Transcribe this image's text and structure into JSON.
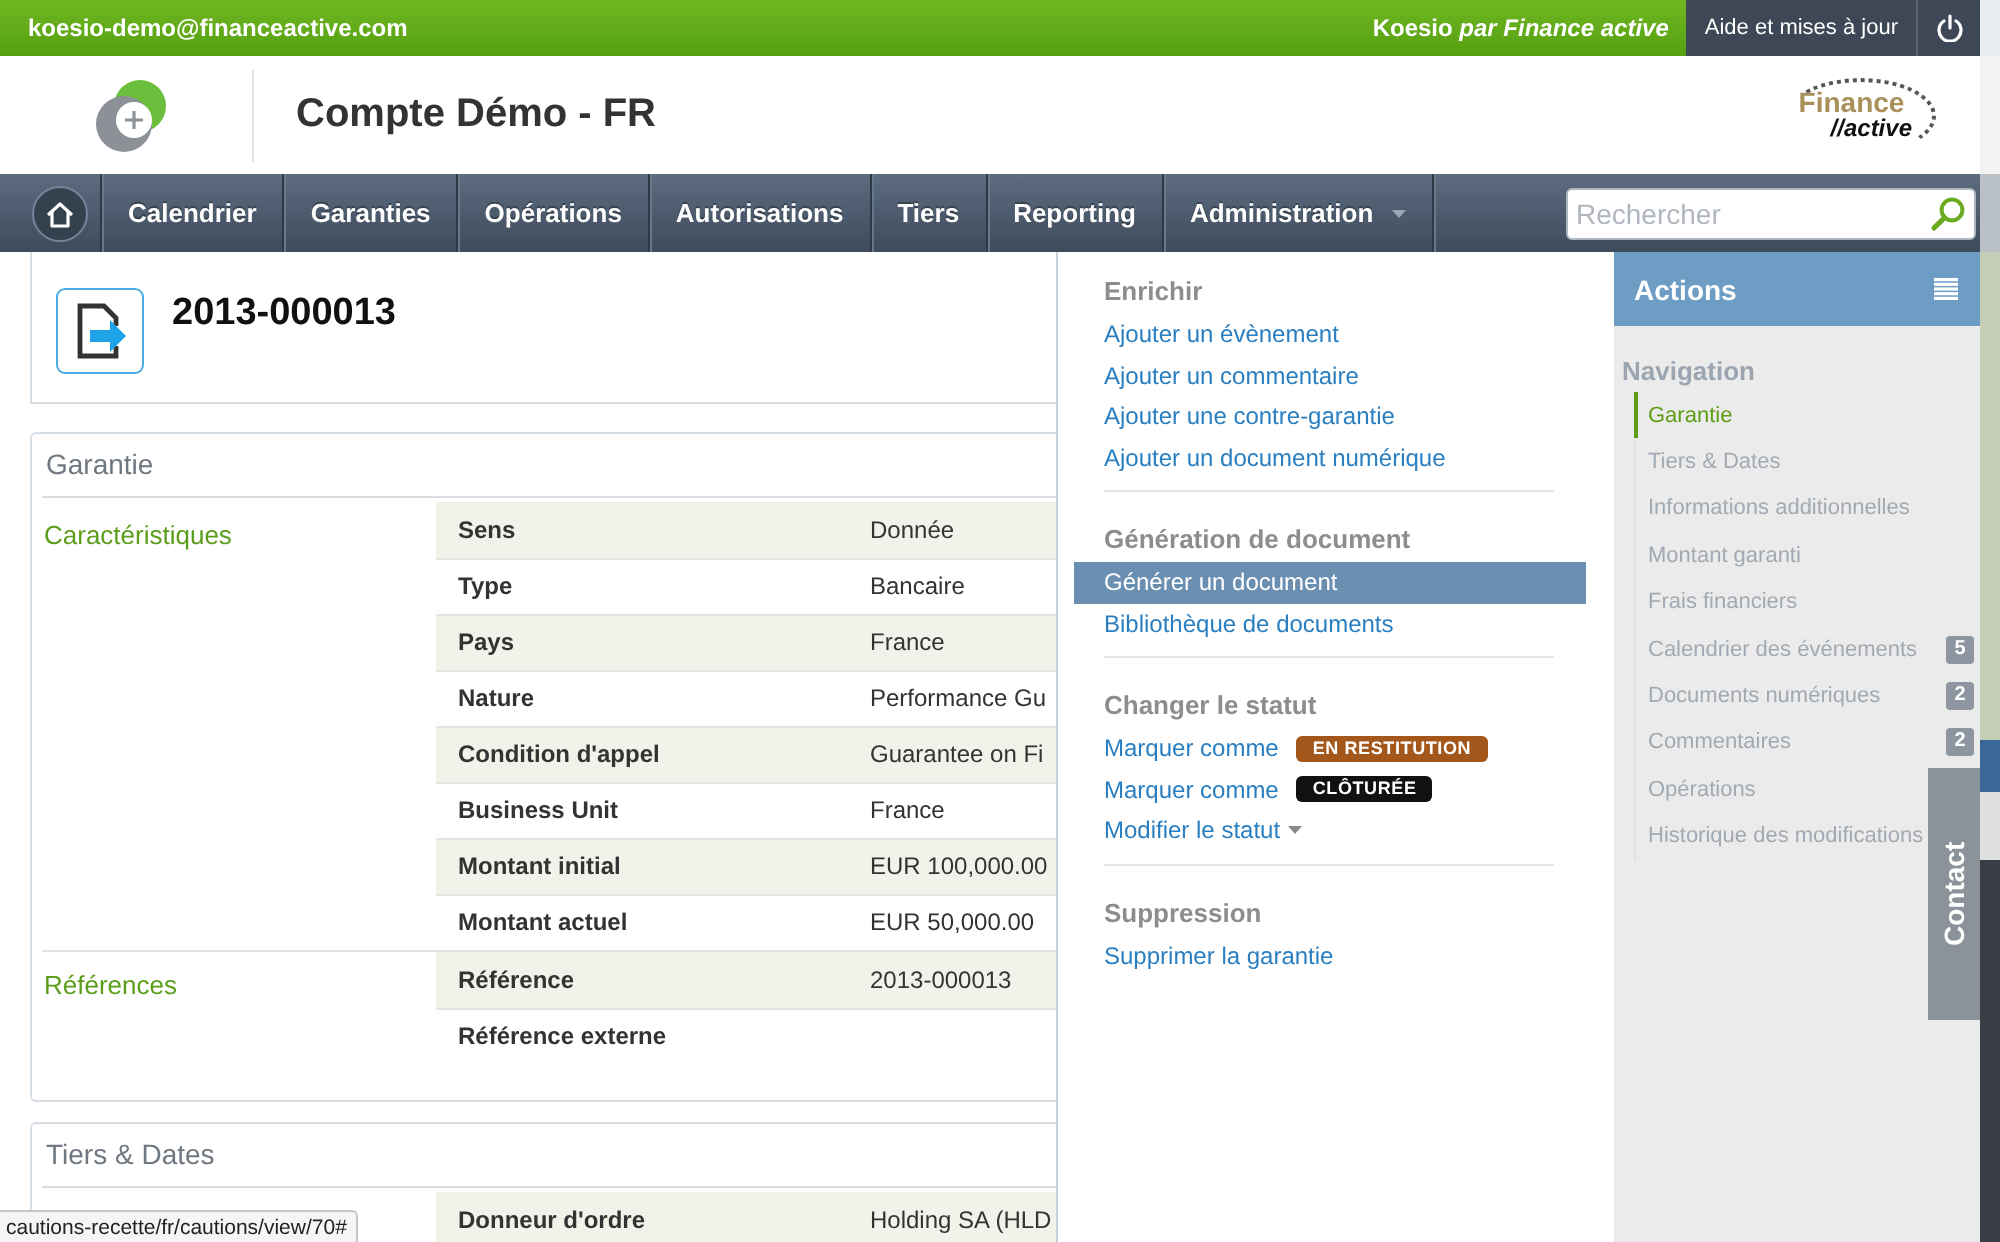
{
  "top_bar": {
    "account": "koesio-demo@financeactive.com",
    "brand": "Koesio *par Finance active*",
    "help_button": "Aide et mises à jour"
  },
  "header": {
    "title": "Compte Démo - FR",
    "logo_lines": [
      "Finance",
      "//active"
    ]
  },
  "nav": {
    "items": [
      {
        "label": "Calendrier",
        "kind": "link"
      },
      {
        "label": "Garanties",
        "kind": "link"
      },
      {
        "label": "Opérations",
        "kind": "link"
      },
      {
        "label": "Autorisations",
        "kind": "link"
      },
      {
        "label": "Tiers",
        "kind": "link"
      },
      {
        "label": "Reporting",
        "kind": "link"
      },
      {
        "label": "Administration",
        "kind": "menu"
      }
    ],
    "search": {
      "placeholder": "Rechercher"
    }
  },
  "record": {
    "title": "2013-000013"
  },
  "sections": [
    {
      "title": "Garantie",
      "groups": [
        {
          "label": "Caractéristiques",
          "rows": [
            {
              "label": "Sens",
              "value": "Donnée"
            },
            {
              "label": "Type",
              "value": "Bancaire"
            },
            {
              "label": "Pays",
              "value": "France"
            },
            {
              "label": "Nature",
              "value": "Performance Gu"
            },
            {
              "label": "Condition d'appel",
              "value": "Guarantee on Fi"
            },
            {
              "label": "Business Unit",
              "value": "France"
            },
            {
              "label": "Montant initial",
              "value": "EUR 100,000.00"
            },
            {
              "label": "Montant actuel",
              "value": "EUR 50,000.00"
            }
          ]
        },
        {
          "label": "Références",
          "rows": [
            {
              "label": "Référence",
              "value": "2013-000013"
            },
            {
              "label": "Référence externe"
            }
          ]
        }
      ]
    },
    {
      "title": "Tiers & Dates",
      "groups": [
        {
          "rows": [
            {
              "label": "Donneur d'ordre",
              "value": "Holding SA (HLD"
            }
          ]
        }
      ]
    }
  ],
  "actions_menu": {
    "sections": [
      {
        "title": "Enrichir",
        "items": [
          {
            "kind": "link",
            "label": "Ajouter un évènement",
            "selected": false
          },
          {
            "kind": "link",
            "label": "Ajouter un commentaire",
            "selected": false
          },
          {
            "kind": "link",
            "label": "Ajouter une contre-garantie",
            "selected": false
          },
          {
            "kind": "link",
            "label": "Ajouter un document numérique",
            "selected": false
          }
        ]
      },
      {
        "title": "Génération de document",
        "items": [
          {
            "kind": "link",
            "label": "Générer un document",
            "selected": true
          },
          {
            "kind": "link",
            "label": "Bibliothèque de documents",
            "selected": false
          }
        ]
      },
      {
        "title": "Changer le statut",
        "items": [
          {
            "kind": "status",
            "label": "Marquer comme",
            "badge": {
              "label": "EN RESTITUTION",
              "color": "#a3571a"
            },
            "selected": false
          },
          {
            "kind": "status",
            "label": "Marquer comme",
            "badge": {
              "label": "CLÔTURÉE",
              "color": "#111111"
            },
            "selected": false
          },
          {
            "kind": "menu",
            "label": "Modifier le statut",
            "selected": false
          }
        ]
      },
      {
        "title": "Suppression",
        "items": [
          {
            "kind": "link",
            "label": "Supprimer la garantie",
            "selected": false
          }
        ]
      }
    ]
  },
  "sidebar": {
    "title": "Actions",
    "navigation_title": "Navigation",
    "items": [
      {
        "label": "Garantie",
        "selected": true
      },
      {
        "label": "Tiers & Dates",
        "selected": false
      },
      {
        "label": "Informations additionnelles",
        "selected": false
      },
      {
        "label": "Montant garanti",
        "selected": false
      },
      {
        "label": "Frais financiers",
        "selected": false
      },
      {
        "label": "Calendrier des événements",
        "selected": false,
        "count": "5"
      },
      {
        "label": "Documents numériques",
        "selected": false,
        "count": "2"
      },
      {
        "label": "Commentaires",
        "selected": false,
        "count": "2"
      },
      {
        "label": "Opérations",
        "selected": false
      },
      {
        "label": "Historique des modifications",
        "selected": false
      }
    ]
  },
  "contact_tab": {
    "label": "Contact"
  },
  "status_url": "cautions-recette/fr/cautions/view/70#"
}
